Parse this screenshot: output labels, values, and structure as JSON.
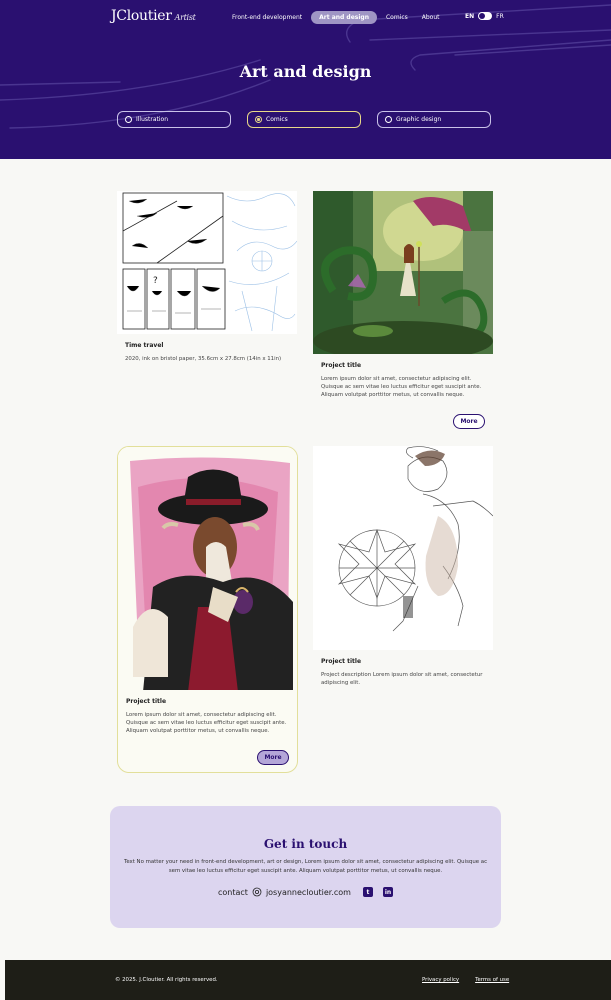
{
  "header": {
    "logo_text": "JCloutier",
    "logo_script": "Artist",
    "nav": [
      {
        "label": "Front-end development"
      },
      {
        "label": "Art and design"
      },
      {
        "label": "Comics"
      },
      {
        "label": "About"
      }
    ],
    "lang_en": "EN",
    "lang_fr": "FR"
  },
  "hero": {
    "title": "Art and design",
    "filters": [
      {
        "label": "Illustration"
      },
      {
        "label": "Comics"
      },
      {
        "label": "Graphic design"
      }
    ]
  },
  "cards": [
    {
      "title": "Time travel",
      "desc": "2020, ink on bristol paper, 35.6cm x 27.8cm (14in x 11in)"
    },
    {
      "title": "Project title",
      "desc": "Lorem ipsum dolor sit amet, consectetur adipiscing elit. Quisque ac sem vitae leo luctus efficitur eget suscipit ante. Aliquam volutpat porttitor metus, ut convallis neque.",
      "more": "More"
    },
    {
      "title": "Project title",
      "desc": "Lorem ipsum dolor sit amet, consectetur adipiscing elit. Quisque ac sem vitae leo luctus efficitur eget suscipit ante. Aliquam volutpat porttitor metus, ut convallis neque.",
      "more": "More"
    },
    {
      "title": "Project title",
      "desc": "Project description Lorem ipsum dolor sit amet, consectetur adipiscing elit."
    }
  ],
  "contact": {
    "title": "Get in touch",
    "text": "Text No matter your need in front-end development, art or design, Lorem ipsum dolor sit amet, consectetur adipiscing elit. Quisque ac sem vitae leo luctus efficitur eget suscipit ante. Aliquam volutpat porttitor metus, ut convallis neque.",
    "label": "contact",
    "email": "josyannecloutier.com",
    "social_tumblr": "t",
    "social_linkedin": "in"
  },
  "footer": {
    "copyright": "© 2025. J.Cloutier. All rights reserved.",
    "privacy": "Privacy policy",
    "terms": "Terms of use"
  },
  "colors": {
    "primary": "#2a1070",
    "accent_yellow": "#e8d889",
    "lavender": "#dcd5ef"
  }
}
